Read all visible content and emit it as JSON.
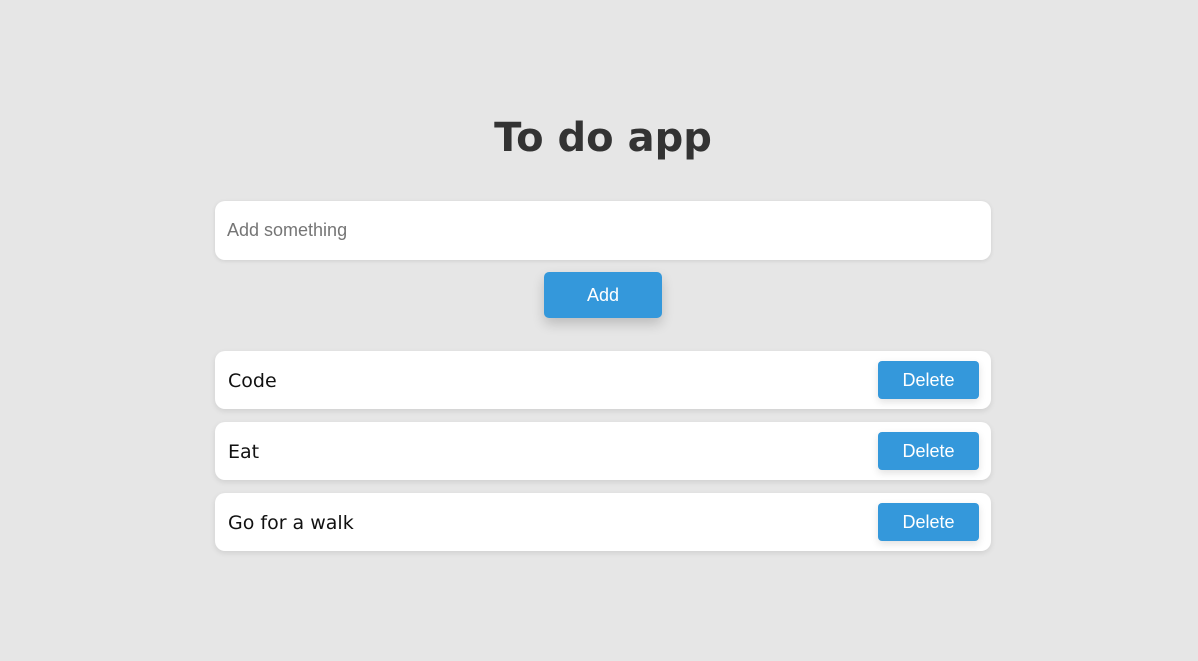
{
  "app": {
    "title": "To do app"
  },
  "input": {
    "placeholder": "Add something",
    "value": ""
  },
  "add_button": {
    "label": "Add"
  },
  "todos": [
    {
      "text": "Code",
      "delete_label": "Delete"
    },
    {
      "text": "Eat",
      "delete_label": "Delete"
    },
    {
      "text": "Go for a walk",
      "delete_label": "Delete"
    }
  ],
  "colors": {
    "background": "#e6e6e6",
    "accent": "#3498db",
    "title": "#333333",
    "card": "#ffffff"
  }
}
